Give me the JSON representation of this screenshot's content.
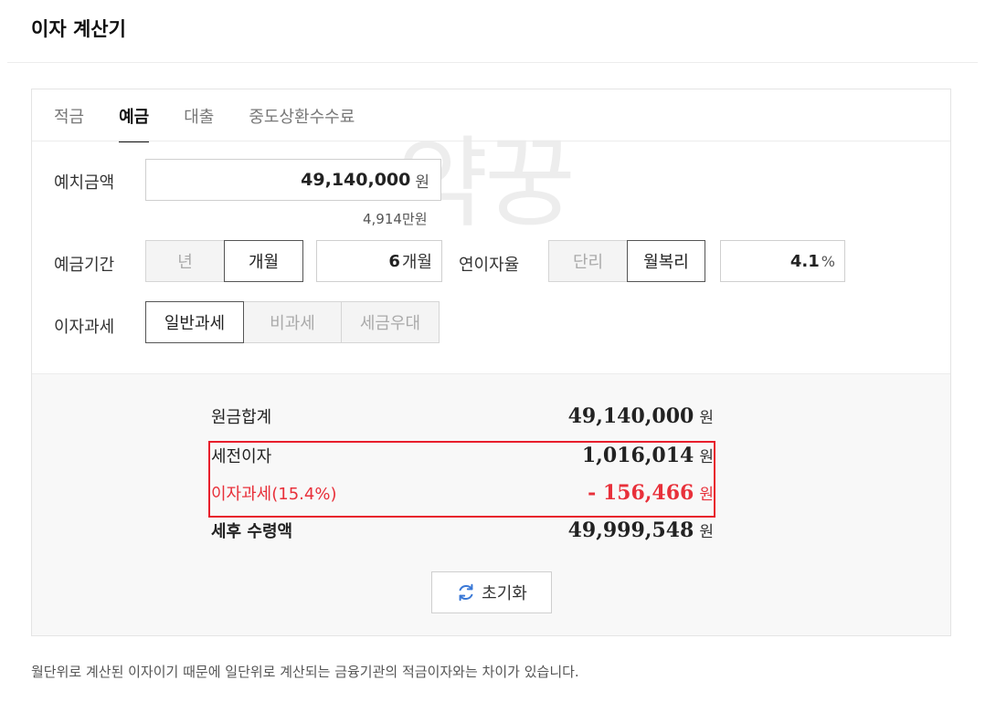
{
  "page": {
    "title": "이자 계산기"
  },
  "tabs": [
    {
      "label": "적금",
      "active": false
    },
    {
      "label": "예금",
      "active": true
    },
    {
      "label": "대출",
      "active": false
    },
    {
      "label": "중도상환수수료",
      "active": false
    }
  ],
  "form": {
    "deposit": {
      "label": "예치금액",
      "value": "49,140,000",
      "unit": "원",
      "sub": "4,914만원"
    },
    "period": {
      "label": "예금기간",
      "options": [
        "년",
        "개월"
      ],
      "selected": "개월",
      "value": "6",
      "unit": "개월"
    },
    "rate": {
      "label": "연이자율",
      "options": [
        "단리",
        "월복리"
      ],
      "selected": "월복리",
      "value": "4.1",
      "unit": "%"
    },
    "tax": {
      "label": "이자과세",
      "options": [
        "일반과세",
        "비과세",
        "세금우대"
      ],
      "selected": "일반과세"
    }
  },
  "results": {
    "principal": {
      "label": "원금합계",
      "value": "49,140,000",
      "unit": "원"
    },
    "pretax_interest": {
      "label": "세전이자",
      "value": "1,016,014",
      "unit": "원"
    },
    "interest_tax": {
      "label": "이자과세(15.4%)",
      "value": "- 156,466",
      "unit": "원"
    },
    "after_tax": {
      "label": "세후 수령액",
      "value": "49,999,548",
      "unit": "원"
    }
  },
  "reset": {
    "label": "초기화",
    "icon": "refresh-icon"
  },
  "footnote": "월단위로 계산된 이자이기 때문에 일단위로 계산되는 금융기관의 적금이자와는 차이가 있습니다.",
  "watermark": "약꿍",
  "colors": {
    "accent_red": "#e8303a",
    "highlight_border": "#e81e2c",
    "result_bg": "#f8f8f8",
    "refresh_icon": "#3a78d6"
  }
}
